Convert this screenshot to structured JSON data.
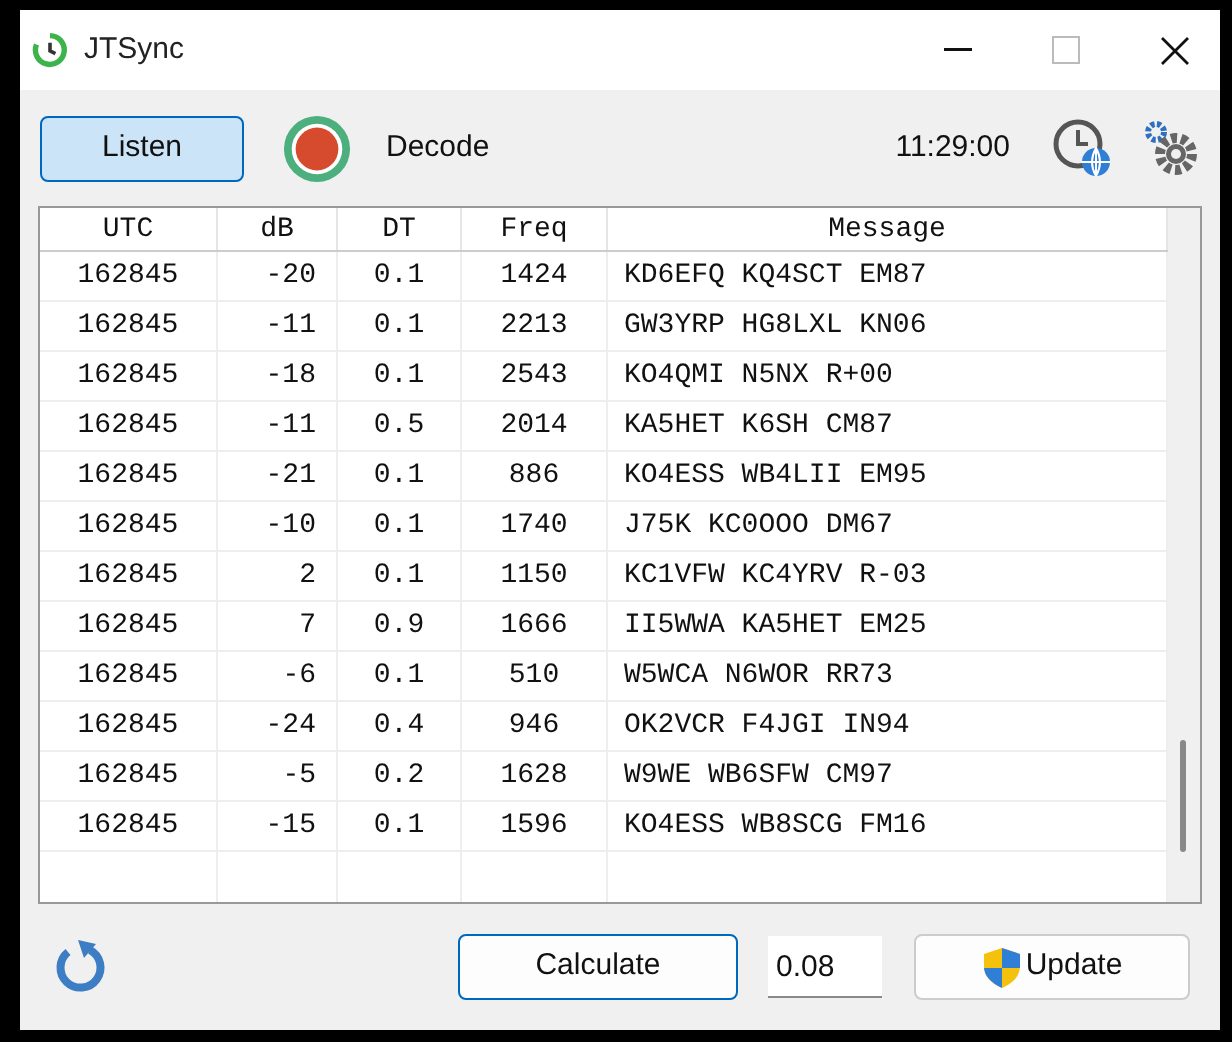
{
  "window": {
    "title": "JTSync"
  },
  "toolbar": {
    "listen_button": "Listen",
    "decode_label": "Decode",
    "time": "11:29:00"
  },
  "table": {
    "columns": [
      "UTC",
      "dB",
      "DT",
      "Freq",
      "Message"
    ],
    "rows": [
      [
        "162845",
        "-20",
        "0.1",
        "1424",
        "KD6EFQ KQ4SCT EM87"
      ],
      [
        "162845",
        "-11",
        "0.1",
        "2213",
        "GW3YRP HG8LXL KN06"
      ],
      [
        "162845",
        "-18",
        "0.1",
        "2543",
        "KO4QMI N5NX R+00"
      ],
      [
        "162845",
        "-11",
        "0.5",
        "2014",
        "KA5HET K6SH CM87"
      ],
      [
        "162845",
        "-21",
        "0.1",
        "886",
        "KO4ESS WB4LII EM95"
      ],
      [
        "162845",
        "-10",
        "0.1",
        "1740",
        "J75K KC0OOO DM67"
      ],
      [
        "162845",
        "2",
        "0.1",
        "1150",
        "KC1VFW KC4YRV R-03"
      ],
      [
        "162845",
        "7",
        "0.9",
        "1666",
        "II5WWA KA5HET EM25"
      ],
      [
        "162845",
        "-6",
        "0.1",
        "510",
        "W5WCA N6WOR RR73"
      ],
      [
        "162845",
        "-24",
        "0.4",
        "946",
        "OK2VCR F4JGI IN94"
      ],
      [
        "162845",
        "-5",
        "0.2",
        "1628",
        "W9WE WB6SFW CM97"
      ],
      [
        "162845",
        "-15",
        "0.1",
        "1596",
        "KO4ESS WB8SCG FM16"
      ]
    ]
  },
  "footer": {
    "calculate_button": "Calculate",
    "offset_value": "0.08",
    "update_button": "Update"
  }
}
